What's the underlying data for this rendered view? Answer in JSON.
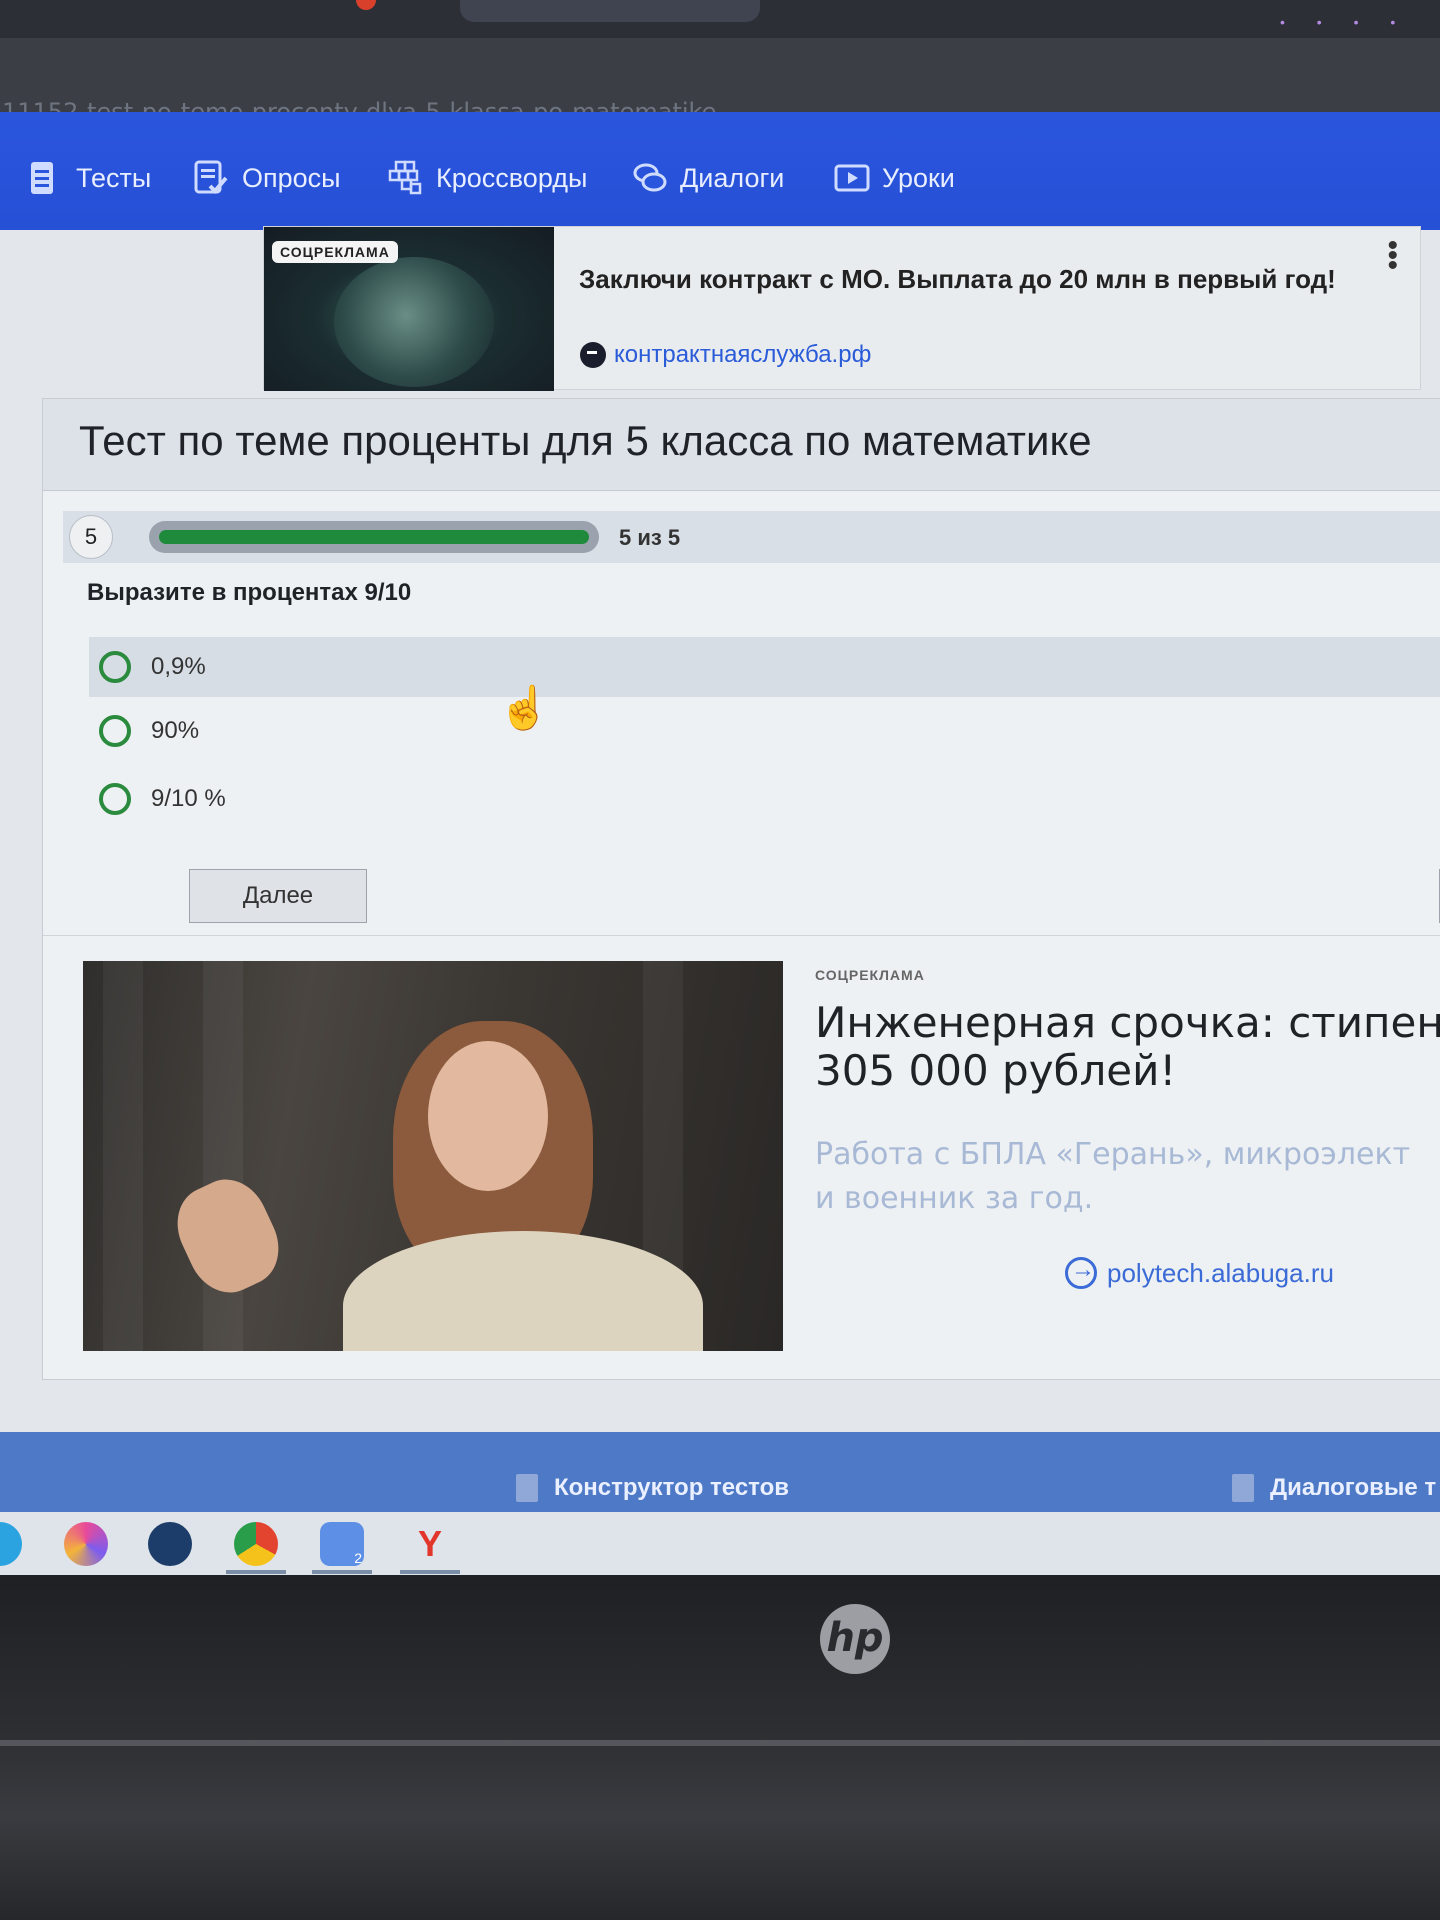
{
  "browser": {
    "url": "11152-test-po-teme-procenty-dlya-5-klassa-po-matematike"
  },
  "nav": {
    "items": [
      {
        "label": "Тесты",
        "icon": "test-doc-icon"
      },
      {
        "label": "Опросы",
        "icon": "survey-check-icon"
      },
      {
        "label": "Кроссворды",
        "icon": "crossword-grid-icon"
      },
      {
        "label": "Диалоги",
        "icon": "dialog-bubbles-icon"
      },
      {
        "label": "Уроки",
        "icon": "lesson-video-icon"
      }
    ]
  },
  "top_ad": {
    "badge": "СОЦРЕКЛАМА",
    "title": "Заключи контракт с МО. Выплата до 20 млн в первый год!",
    "link": "контрактнаяслужба.рф",
    "menu": "⋮"
  },
  "test": {
    "title": "Тест по теме проценты для 5 класса по математике",
    "question_number": "5",
    "progress_text": "5 из 5",
    "progress_fraction": 1.0,
    "question": "Выразите в процентах 9/10",
    "options": [
      {
        "label": "0,9%"
      },
      {
        "label": "90%"
      },
      {
        "label": "9/10 %"
      }
    ],
    "next_label": "Далее"
  },
  "bottom_ad": {
    "badge": "СОЦРЕКЛАМА",
    "title_line1": "Инженерная срочка: стипенди",
    "title_line2": "305 000 рублей!",
    "desc_line1": "Работа с БПЛА «Герань», микроэлект",
    "desc_line2": "и военник за год.",
    "link": "polytech.alabuga.ru"
  },
  "footer": {
    "items": [
      {
        "label": "Конструктор тестов"
      },
      {
        "label": "Диалоговые т"
      }
    ]
  },
  "taskbar": {
    "badge_count": "2"
  },
  "laptop": {
    "logo": "hp"
  },
  "colors": {
    "nav_blue": "#2a55dd",
    "progress_green": "#1f8a3c",
    "radio_green": "#2a8a3e",
    "link_blue": "#2a5bd8",
    "footer_blue": "#4d79c7"
  }
}
